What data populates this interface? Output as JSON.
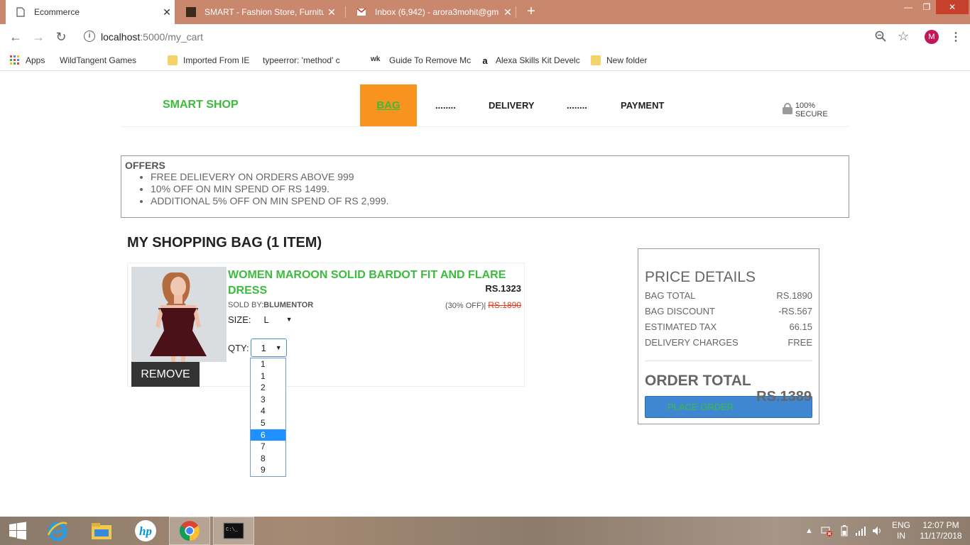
{
  "browser": {
    "tabs": [
      {
        "title": "Ecommerce",
        "active": true
      },
      {
        "title": "SMART - Fashion Store, Furniture",
        "active": false
      },
      {
        "title": "Inbox (6,942) - arora3mohit@gm",
        "active": false
      }
    ],
    "url_host": "localhost",
    "url_path": ":5000/my_cart",
    "avatar_letter": "M",
    "bookmarks": [
      {
        "label": "Apps",
        "icon": "apps-grid-icon"
      },
      {
        "label": "WildTangent Games",
        "icon": "page-icon"
      },
      {
        "label": "Imported From IE",
        "icon": "folder-icon"
      },
      {
        "label": "typeerror: 'method' c",
        "icon": "page-icon"
      },
      {
        "label": "Guide To Remove Mc",
        "icon": "wk-icon"
      },
      {
        "label": "Alexa Skills Kit Develc",
        "icon": "amazon-icon"
      },
      {
        "label": "New folder",
        "icon": "folder-icon"
      }
    ]
  },
  "header": {
    "logo": "SMART SHOP",
    "steps": {
      "bag": "BAG",
      "dots1": "........",
      "delivery": "DELIVERY",
      "dots2": "........",
      "payment": "PAYMENT"
    },
    "secure": "100% SECURE"
  },
  "offers": {
    "title": "OFFERS",
    "items": [
      "FREE DELIEVERY ON ORDERS ABOVE 999",
      "10% OFF ON MIN SPEND OF RS 1499.",
      "ADDITIONAL 5% OFF ON MIN SPEND OF RS 2,999."
    ]
  },
  "bag": {
    "title": "MY SHOPPING BAG (1 ITEM)",
    "item": {
      "name": "WOMEN MAROON SOLID BARDOT FIT AND FLARE DRESS",
      "price": "RS.1323",
      "sold_by_label": "SOLD BY:",
      "sold_by": "BLUMENTOR",
      "discount": "(30% OFF)|",
      "original_price": "RS.1890",
      "size_label": "SIZE:",
      "size_value": "L",
      "qty_label": "QTY:",
      "qty_value": "1",
      "qty_options": [
        "1",
        "1",
        "2",
        "3",
        "4",
        "5",
        "6",
        "7",
        "8",
        "9"
      ],
      "qty_highlighted": "6",
      "remove_label": "REMOVE"
    }
  },
  "price_details": {
    "title": "PRICE DETAILS",
    "rows": [
      {
        "label": "BAG TOTAL",
        "value": "RS.1890"
      },
      {
        "label": "BAG DISCOUNT",
        "value": "-RS.567"
      },
      {
        "label": "ESTIMATED TAX",
        "value": "66.15"
      },
      {
        "label": "DELIVERY CHARGES",
        "value": "FREE"
      }
    ],
    "order_total_label": "ORDER TOTAL",
    "order_total_value": "RS.1389",
    "place_order_label": "PLACE ORDER"
  },
  "taskbar": {
    "lang": "ENG",
    "region": "IN",
    "time": "12:07 PM",
    "date": "11/17/2018"
  },
  "colors": {
    "accent_green": "#3cbc3c",
    "active_step": "#f7931e",
    "place_order": "#3f87d1",
    "strike": "#e53a1e"
  }
}
